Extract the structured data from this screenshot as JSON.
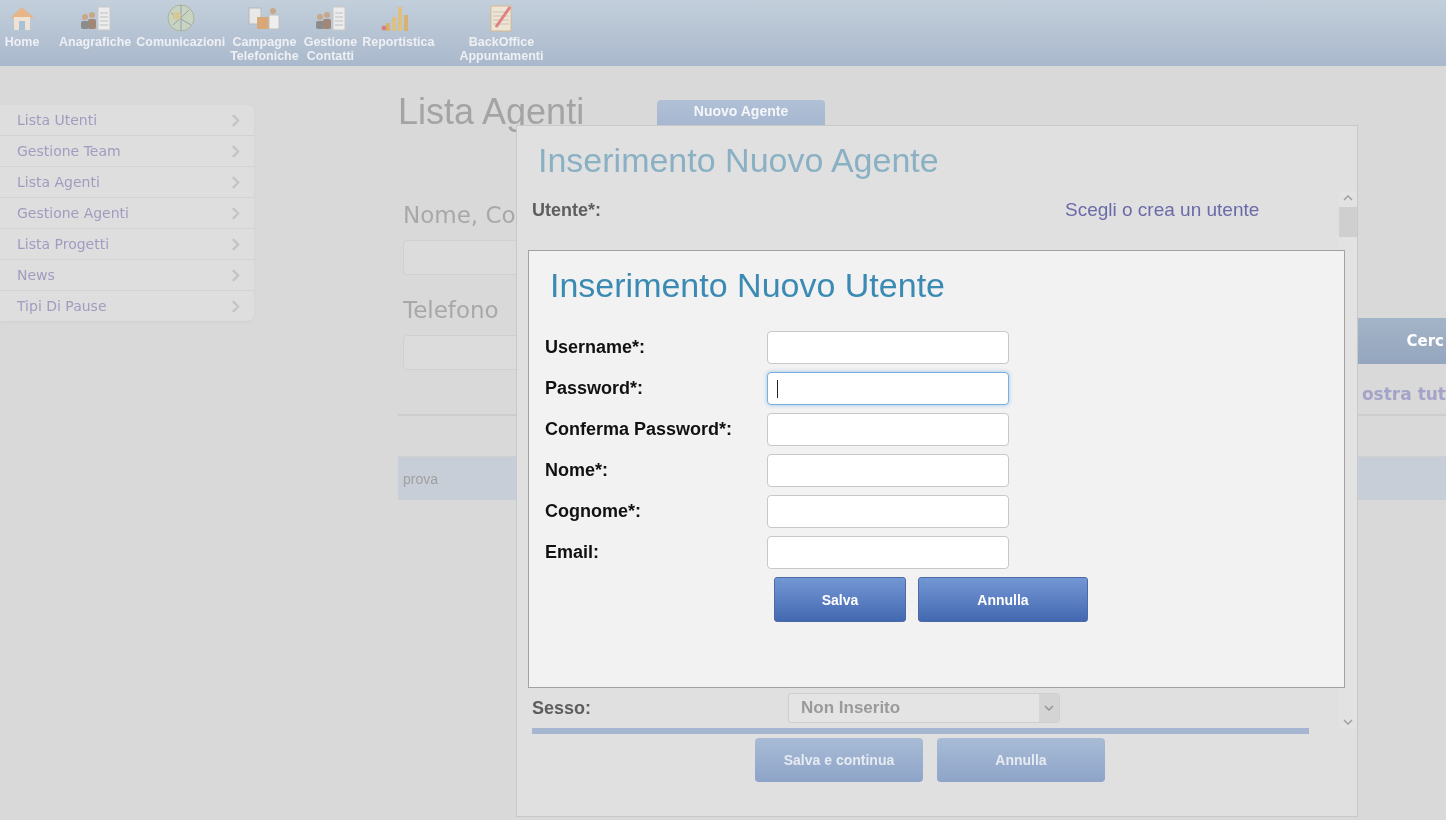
{
  "nav": [
    {
      "label": "Home"
    },
    {
      "label": "Anagrafiche"
    },
    {
      "label": "Comunicazioni"
    },
    {
      "label": "Campagne\nTelefoniche"
    },
    {
      "label": "Gestione\nContatti"
    },
    {
      "label": "Reportistica"
    },
    {
      "label": "BackOffice\nAppuntamenti"
    }
  ],
  "sidebar": {
    "items": [
      {
        "label": "Lista Utenti"
      },
      {
        "label": "Gestione Team"
      },
      {
        "label": "Lista Agenti"
      },
      {
        "label": "Gestione Agenti"
      },
      {
        "label": "Lista Progetti"
      },
      {
        "label": "News"
      },
      {
        "label": "Tipi Di Pause"
      }
    ]
  },
  "page": {
    "title": "Lista Agenti",
    "new_button": "Nuovo Agente",
    "filters": [
      {
        "label": "Nome, Co"
      },
      {
        "label": "Telefono"
      }
    ],
    "search_button": "Cerc",
    "show_all_link": "ostra tut",
    "table": {
      "rows": [
        {
          "cells": [
            "prova"
          ]
        }
      ]
    }
  },
  "agent_dialog": {
    "title": "Inserimento Nuovo Agente",
    "user_label": "Utente*:",
    "user_link": "Scegli o crea un utente",
    "sex_label": "Sesso:",
    "sex_select": {
      "value": "Non Inserito"
    },
    "buttons": [
      "Salva e continua",
      "Annulla"
    ]
  },
  "user_dialog": {
    "title": "Inserimento Nuovo Utente",
    "fields": [
      {
        "label": "Username*:",
        "focused": false
      },
      {
        "label": "Password*:",
        "focused": true
      },
      {
        "label": "Conferma Password*:",
        "focused": false
      },
      {
        "label": "Nome*:",
        "focused": false
      },
      {
        "label": "Cognome*:",
        "focused": false
      },
      {
        "label": "Email:",
        "focused": false
      }
    ],
    "buttons": [
      "Salva",
      "Annulla"
    ]
  }
}
